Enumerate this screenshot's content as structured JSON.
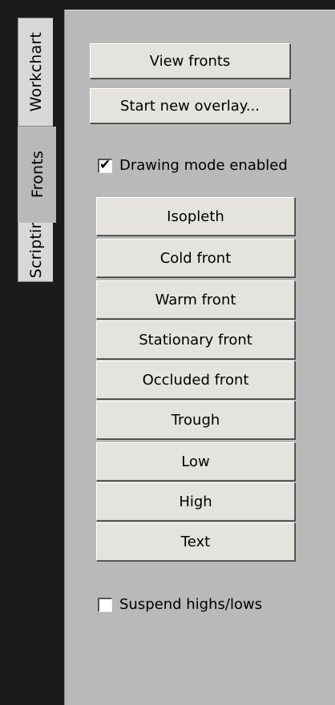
{
  "tabs": [
    {
      "label": "Workchart"
    },
    {
      "label": "Fronts"
    },
    {
      "label": "Scripting"
    }
  ],
  "active_tab": "Fronts",
  "overlay_buttons": {
    "view_fronts": "View fronts",
    "start_overlay": "Start new overlay..."
  },
  "drawing_mode": {
    "label": "Drawing mode enabled",
    "checked": true
  },
  "draw_tools": [
    "Isopleth",
    "Cold front",
    "Warm front",
    "Stationary front",
    "Occluded front",
    "Trough",
    "Low",
    "High",
    "Text"
  ],
  "suspend": {
    "label": "Suspend highs/lows",
    "checked": false
  }
}
